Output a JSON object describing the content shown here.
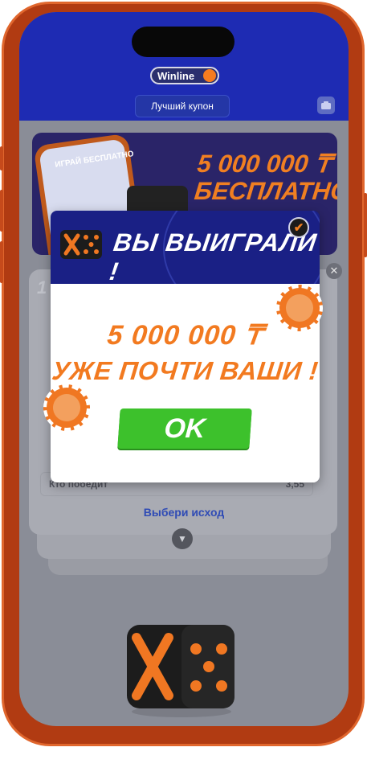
{
  "header": {
    "brand": "Winline",
    "best_coupon_label": "Лучший купон"
  },
  "banner": {
    "play_label": "ИГРАЙ БЕСПЛАТНО",
    "headline_line1": "5 000 000 ₸",
    "headline_line2": "БЕСПЛАТНО!"
  },
  "card": {
    "number": "1",
    "row_label": "Кто победит",
    "row_value": "3,55",
    "choose_outcome": "Выбери исход"
  },
  "modal": {
    "title": "ВЫ ВЫИГРАЛИ !",
    "amount": "5 000 000 ₸",
    "subtitle": "УЖЕ ПОЧТИ ВАШИ !",
    "ok_label": "OK"
  },
  "colors": {
    "accent": "#f27a20",
    "ok_green": "#3dc12c",
    "header_blue": "#1e2bb3",
    "modal_navy": "#1a2085"
  },
  "icons": [
    "coupon-icon",
    "close-icon",
    "chevron-down-icon",
    "check-icon",
    "dice-logo-icon",
    "poker-chip-icon"
  ]
}
